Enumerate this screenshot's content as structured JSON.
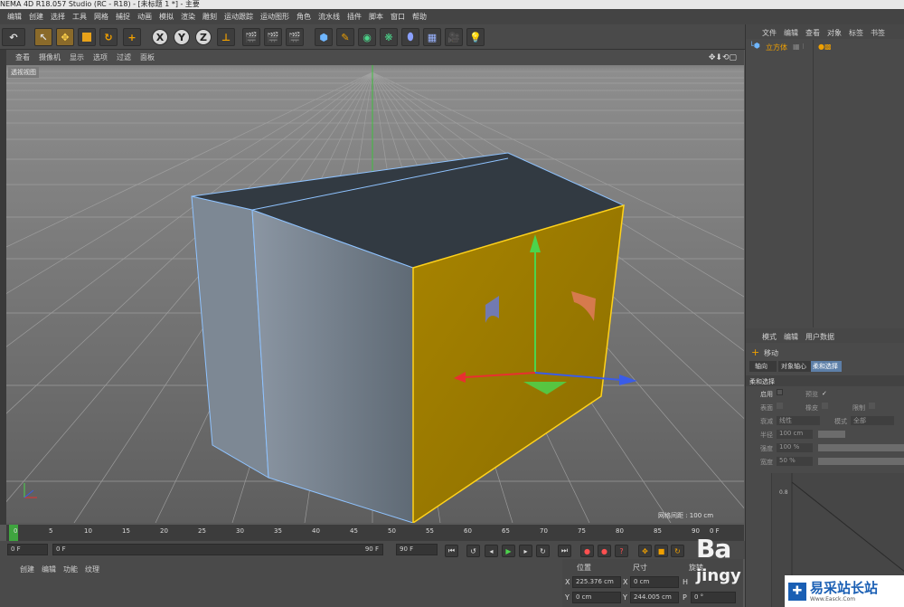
{
  "title": "NEMA 4D R18.057 Studio (RC - R18) - [未标题 1 *] - 主要",
  "menu": [
    "编辑",
    "创建",
    "选择",
    "工具",
    "网格",
    "捕捉",
    "动画",
    "模拟",
    "渲染",
    "雕刻",
    "运动跟踪",
    "运动图形",
    "角色",
    "流水线",
    "插件",
    "脚本",
    "窗口",
    "帮助"
  ],
  "toolbar": {
    "x": "X",
    "y": "Y",
    "z": "Z"
  },
  "viewport_menu": [
    "查看",
    "摄像机",
    "显示",
    "选项",
    "过滤",
    "面板"
  ],
  "viewport_label": "透视视图",
  "grid_spacing": "网格间距 : 100 cm",
  "timeline_ticks": [
    "0",
    "5",
    "10",
    "15",
    "20",
    "25",
    "30",
    "35",
    "40",
    "45",
    "50",
    "55",
    "60",
    "65",
    "70",
    "75",
    "80",
    "85",
    "90"
  ],
  "timeline_end": "0 F",
  "transport": {
    "start": "0 F",
    "range_start": "0 F",
    "range_end": "90 F",
    "end": "90 F"
  },
  "bottom_menu": [
    "创建",
    "编辑",
    "功能",
    "纹理"
  ],
  "coords": {
    "position_label": "位置",
    "size_label": "尺寸",
    "rotation_label": "旋转",
    "x_label": "X",
    "y_label": "Y",
    "h_label": "H",
    "p_label": "P",
    "pos_x": "225.376 cm",
    "pos_y": "0 cm",
    "size_x": "0 cm",
    "size_y": "244.005 cm",
    "rot_p": "0 °"
  },
  "object_manager": {
    "tabs": [
      "文件",
      "编辑",
      "查看",
      "对象",
      "标签",
      "书签"
    ],
    "object_name": "立方体"
  },
  "attribute_manager": {
    "tabs": [
      "模式",
      "编辑",
      "用户数据"
    ],
    "tool_name": "移动",
    "subtabs": [
      "轴向",
      "对象轴心",
      "柔和选择"
    ],
    "section": "柔和选择",
    "enable_label": "启用",
    "preview_label": "预览",
    "surface_label": "表面",
    "rubber_label": "橡皮",
    "limit_label": "限制",
    "falloff_label": "衰减",
    "falloff_value": "线性",
    "mode_label": "模式",
    "mode_value": "全部",
    "radius_label": "半径",
    "radius_value": "100 cm",
    "strength_label": "强度",
    "strength_value": "100 %",
    "width_label": "宽度",
    "width_value": "50 %",
    "graph_value": "0.8"
  },
  "watermark": {
    "line1": "Ba",
    "line2": "jingy",
    "logo_text": "易采站长站",
    "logo_sub": "Www.Easck.Com"
  },
  "colors": {
    "selected_face": "#b08a00",
    "accent": "#f0a000",
    "highlight_tab": "#5d7fa8"
  }
}
